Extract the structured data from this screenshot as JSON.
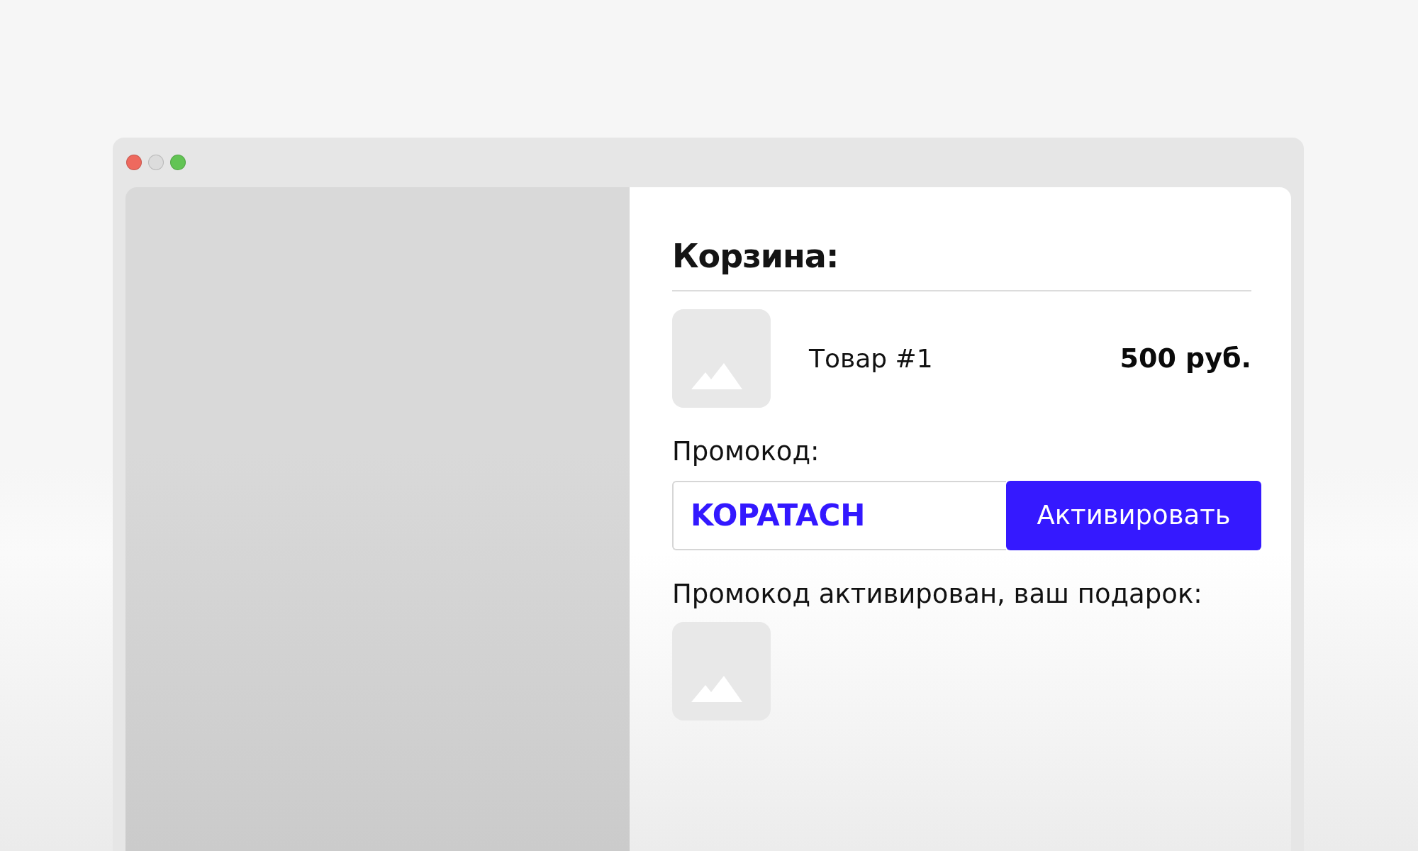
{
  "window": {
    "controls": [
      {
        "color": "#ee695e"
      },
      {
        "color": "#dcdcdc"
      },
      {
        "color": "#62c454"
      }
    ]
  },
  "cart": {
    "title": "Корзина:",
    "items": [
      {
        "name": "Товар #1",
        "price": "500 руб."
      }
    ]
  },
  "promo": {
    "label": "Промокод:",
    "value": "KOPATACH",
    "button": "Активировать",
    "message": "Промокод активирован, ваш подарок:"
  }
}
